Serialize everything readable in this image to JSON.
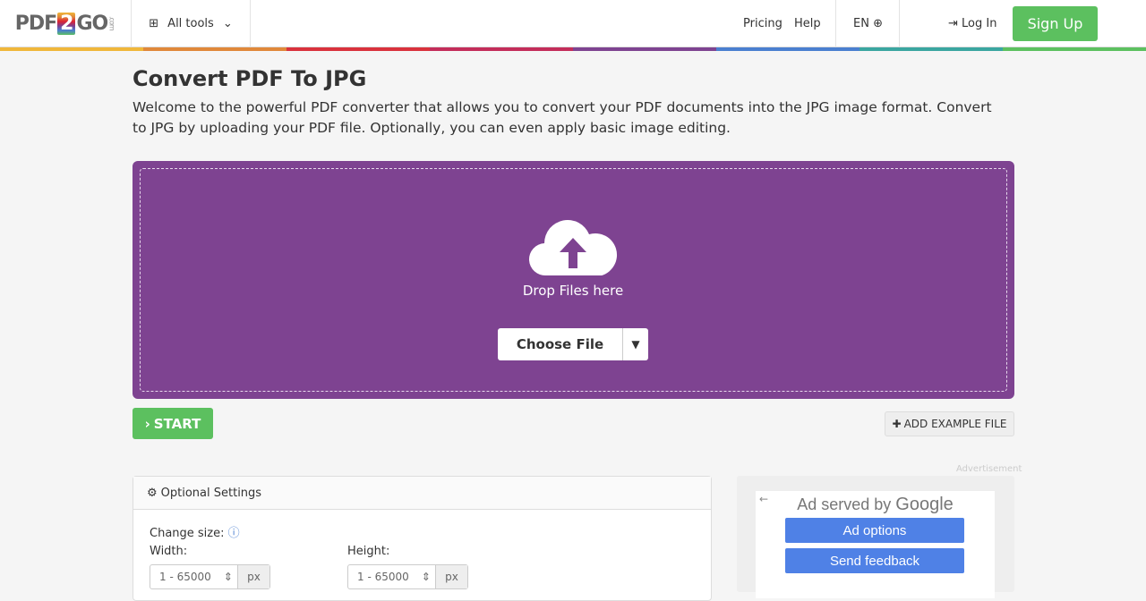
{
  "header": {
    "logo": {
      "left": "PDF",
      "mid": "2",
      "right": "GO",
      "suffix": ".com"
    },
    "all_tools": "All tools",
    "pricing": "Pricing",
    "help": "Help",
    "lang": "EN",
    "login": "Log In",
    "signup": "Sign Up"
  },
  "brand_colors": [
    "#f0b73a",
    "#e0883a",
    "#d9323c",
    "#c32d5a",
    "#7e4391",
    "#4a7fd0",
    "#3aa6a0",
    "#5cc05f"
  ],
  "page": {
    "title": "Convert PDF To JPG",
    "description": "Welcome to the powerful PDF converter that allows you to convert your PDF documents into the JPG image format. Convert to JPG by uploading your PDF file. Optionally, you can even apply basic image editing."
  },
  "upload": {
    "drop_text": "Drop Files here",
    "choose_file": "Choose File"
  },
  "actions": {
    "start": "START",
    "add_example": "ADD EXAMPLE FILE"
  },
  "settings": {
    "title": "Optional Settings",
    "change_size": "Change size:",
    "width_label": "Width:",
    "height_label": "Height:",
    "width_placeholder": "1 - 65000",
    "height_placeholder": "1 - 65000",
    "unit": "px"
  },
  "ad": {
    "label": "Advertisement",
    "served_by": "Ad served by",
    "google": "Google",
    "options": "Ad options",
    "feedback": "Send feedback"
  }
}
